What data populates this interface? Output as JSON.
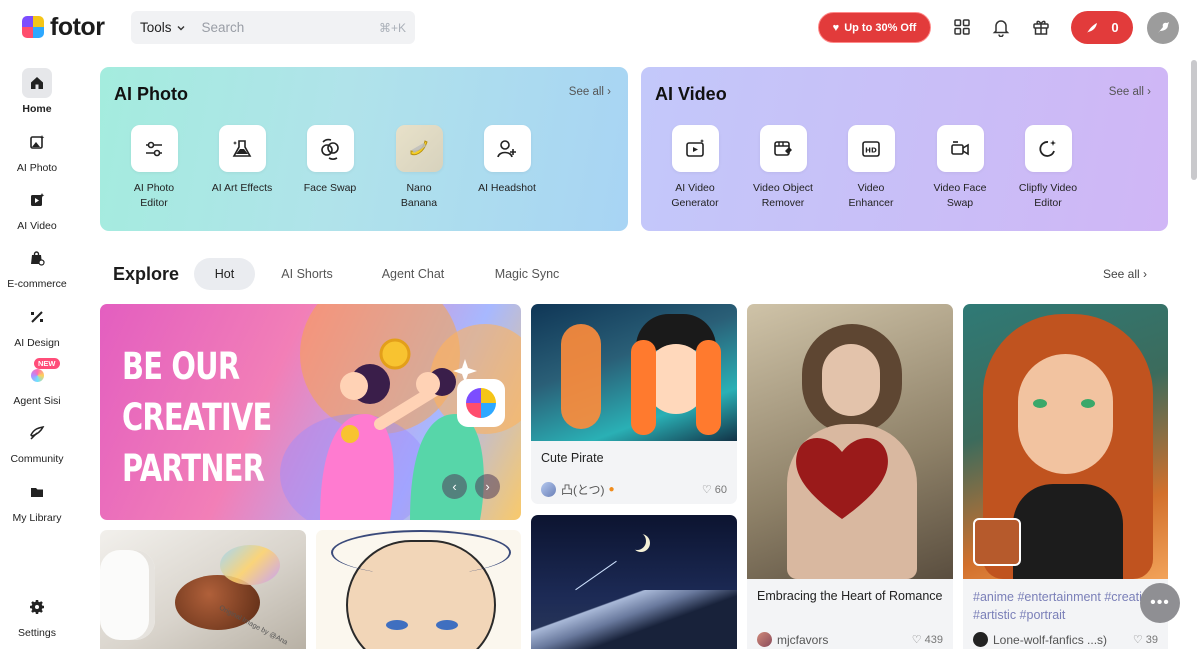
{
  "app": {
    "logo_text": "fotor"
  },
  "header": {
    "tools_label": "Tools",
    "search_placeholder": "Search",
    "search_shortcut": "⌘+K",
    "promo_label": "Up to 30% Off",
    "credits_count": "0"
  },
  "sidebar": {
    "items": [
      {
        "label": "Home",
        "icon": "home-icon"
      },
      {
        "label": "AI Photo",
        "icon": "ai-photo-icon"
      },
      {
        "label": "AI Video",
        "icon": "ai-video-icon"
      },
      {
        "label": "E-commerce",
        "icon": "shopping-bag-icon"
      },
      {
        "label": "AI Design",
        "icon": "design-icon"
      },
      {
        "label": "Agent Sisi",
        "icon": "agent-orb-icon",
        "badge": "NEW"
      },
      {
        "label": "Community",
        "icon": "community-icon"
      },
      {
        "label": "My Library",
        "icon": "folder-icon"
      },
      {
        "label": "Settings",
        "icon": "gear-icon"
      }
    ]
  },
  "ai_photo": {
    "title": "AI Photo",
    "see_all": "See all",
    "tools": [
      {
        "line1": "AI Photo",
        "line2": "Editor"
      },
      {
        "line1": "AI Art Effects",
        "line2": ""
      },
      {
        "line1": "Face Swap",
        "line2": ""
      },
      {
        "line1": "Nano",
        "line2": "Banana"
      },
      {
        "line1": "AI Headshot",
        "line2": ""
      }
    ]
  },
  "ai_video": {
    "title": "AI Video",
    "see_all": "See all",
    "tools": [
      {
        "line1": "AI Video",
        "line2": "Generator"
      },
      {
        "line1": "Video Object",
        "line2": "Remover"
      },
      {
        "line1": "Video",
        "line2": "Enhancer"
      },
      {
        "line1": "Video Face",
        "line2": "Swap"
      },
      {
        "line1": "Clipfly Video",
        "line2": "Editor"
      }
    ]
  },
  "explore": {
    "title": "Explore",
    "tabs": [
      "Hot",
      "AI Shorts",
      "Agent Chat",
      "Magic Sync"
    ],
    "see_all": "See all",
    "banner_lines": [
      "BE OUR",
      "CREATIVE",
      "PARTNER"
    ],
    "posts": [
      {
        "title": "Cute Pirate",
        "author": "凸(とつ)",
        "likes": "60"
      },
      {
        "title": "Embracing the Heart of Romance",
        "author": "mjcfavors",
        "likes": "439"
      },
      {
        "title": "#anime #entertainment #creative #artistic #portrait",
        "author": "Lone-wolf-fanfics ...s)",
        "likes": "39"
      }
    ],
    "watermark": "Original Image by @Ana"
  },
  "colors": {
    "accent_red": "#e23b3b",
    "photo_card": "#a8e6e0",
    "video_card": "#c8c1f8"
  }
}
